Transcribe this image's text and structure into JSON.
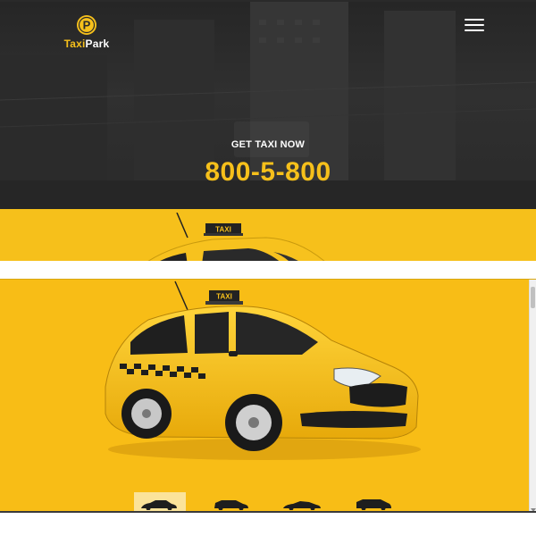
{
  "brand": {
    "name_part1": "Taxi",
    "name_part2": "Park",
    "logo_letter": "P",
    "accent": "#f6c01b"
  },
  "header": {
    "menu_icon": "hamburger-icon"
  },
  "hero": {
    "cta_label": "GET TAXI NOW",
    "phone": "800-5-800"
  },
  "car": {
    "roof_sign": "TAXI"
  },
  "gallery": {
    "thumbs": [
      {
        "name": "sedan",
        "active": true
      },
      {
        "name": "hatchback",
        "active": false
      },
      {
        "name": "sports",
        "active": false
      },
      {
        "name": "suv",
        "active": false
      }
    ]
  },
  "colors": {
    "dark_bg": "#2a2a2a",
    "yellow": "#f6c01b",
    "white": "#ffffff"
  }
}
